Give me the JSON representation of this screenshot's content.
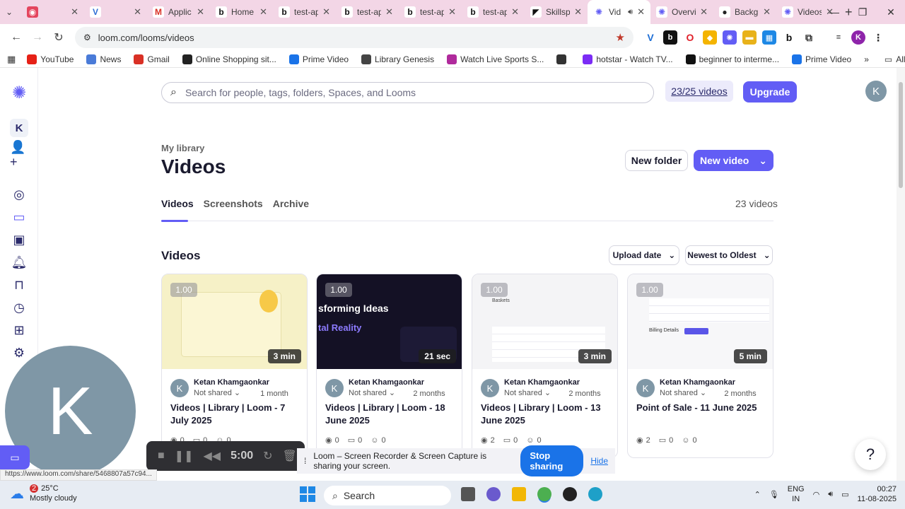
{
  "browser": {
    "tabs": [
      {
        "title": "",
        "fav": "◉",
        "color": "#e4455e",
        "text": "#fff"
      },
      {
        "title": "",
        "fav": "V",
        "color": "#fff",
        "text": "#2f6fd6"
      },
      {
        "title": "Applic",
        "fav": "M",
        "color": "#fff",
        "text": "#d93025"
      },
      {
        "title": "Home",
        "fav": "b",
        "color": "#fff",
        "text": "#111"
      },
      {
        "title": "test-ap",
        "fav": "b",
        "color": "#fff",
        "text": "#111"
      },
      {
        "title": "test-ap",
        "fav": "b",
        "color": "#fff",
        "text": "#111"
      },
      {
        "title": "test-ap",
        "fav": "b",
        "color": "#fff",
        "text": "#111"
      },
      {
        "title": "test-ap",
        "fav": "b",
        "color": "#fff",
        "text": "#111"
      },
      {
        "title": "Skillsp",
        "fav": "◤",
        "color": "#fff",
        "text": "#111"
      },
      {
        "title": "Vid",
        "fav": "✺",
        "color": "#fff",
        "text": "#625df5",
        "active": true
      },
      {
        "title": "Overvi",
        "fav": "✺",
        "color": "#fff",
        "text": "#625df5"
      },
      {
        "title": "Backgr",
        "fav": "●",
        "color": "#fff",
        "text": "#222"
      },
      {
        "title": "Videos",
        "fav": "✺",
        "color": "#fff",
        "text": "#625df5"
      }
    ],
    "url": "loom.com/looms/videos",
    "bookmarks": [
      {
        "label": "YouTube",
        "color": "#e62117"
      },
      {
        "label": "News",
        "color": "#4a7bd8"
      },
      {
        "label": "Gmail",
        "color": "#d93025"
      },
      {
        "label": "Online Shopping sit...",
        "color": "#222"
      },
      {
        "label": "Prime Video",
        "color": "#1a73e8"
      },
      {
        "label": "Library Genesis",
        "color": "#444"
      },
      {
        "label": "Watch Live Sports S...",
        "color": "#b02a9c"
      },
      {
        "label": "",
        "color": "#333"
      },
      {
        "label": "hotstar - Watch TV...",
        "color": "#7b2cf5"
      },
      {
        "label": "beginner to interme...",
        "color": "#111"
      },
      {
        "label": "Prime Video",
        "color": "#1a73e8"
      }
    ],
    "all_bookmarks": "All Bookmarks"
  },
  "loom": {
    "search_placeholder": "Search for people, tags, folders, Spaces, and Looms",
    "quota": "23/25 videos",
    "upgrade": "Upgrade",
    "avatar_initial": "K",
    "breadcrumb": "My library",
    "title": "Videos",
    "new_folder": "New folder",
    "new_video": "New video",
    "tabs": [
      "Videos",
      "Screenshots",
      "Archive"
    ],
    "count": "23 videos",
    "section": "Videos",
    "sort_field": "Upload date",
    "sort_order": "Newest to Oldest"
  },
  "videos": [
    {
      "speed": "1.00",
      "duration": "3 min",
      "owner": "Ketan Khamgaonkar",
      "shared": "Not shared",
      "age": "1 month",
      "title": "Videos | Library | Loom - 7 July 2025",
      "views": "0",
      "comments": "0",
      "reactions": "0",
      "thumb": "#f6f1c7"
    },
    {
      "speed": "1.00",
      "duration": "21 sec",
      "owner": "Ketan Khamgaonkar",
      "shared": "Not shared",
      "age": "2 months",
      "title": "Videos | Library | Loom - 18 June 2025",
      "views": "0",
      "comments": "0",
      "reactions": "0",
      "thumb": "#141125",
      "thumb_text1": "sforming Ideas",
      "thumb_text2": "tal Reality"
    },
    {
      "speed": "1.00",
      "duration": "3 min",
      "owner": "Ketan Khamgaonkar",
      "shared": "Not shared",
      "age": "2 months",
      "title": "Videos | Library | Loom - 13 June 2025",
      "views": "2",
      "comments": "0",
      "reactions": "0",
      "thumb": "#f4f4f6",
      "thumb_text1": "Baskets"
    },
    {
      "speed": "1.00",
      "duration": "5 min",
      "owner": "Ketan Khamgaonkar",
      "shared": "Not shared",
      "age": "2 months",
      "title": "Point of Sale - 11 June 2025",
      "views": "2",
      "comments": "0",
      "reactions": "0",
      "thumb": "#f7f7f9",
      "thumb_text1": "Billing Details"
    }
  ],
  "recorder": {
    "time": "5:00",
    "initial": "K"
  },
  "share_bar": {
    "message": "Loom – Screen Recorder & Screen Capture is sharing your screen.",
    "stop": "Stop sharing",
    "hide": "Hide"
  },
  "status_url": "https://www.loom.com/share/5468807a57c94...",
  "taskbar": {
    "weather_temp": "25°C",
    "weather_desc": "Mostly cloudy",
    "weather_badge": "2",
    "search": "Search",
    "lang1": "ENG",
    "lang2": "IN",
    "time": "00:27",
    "date": "11-08-2025"
  }
}
